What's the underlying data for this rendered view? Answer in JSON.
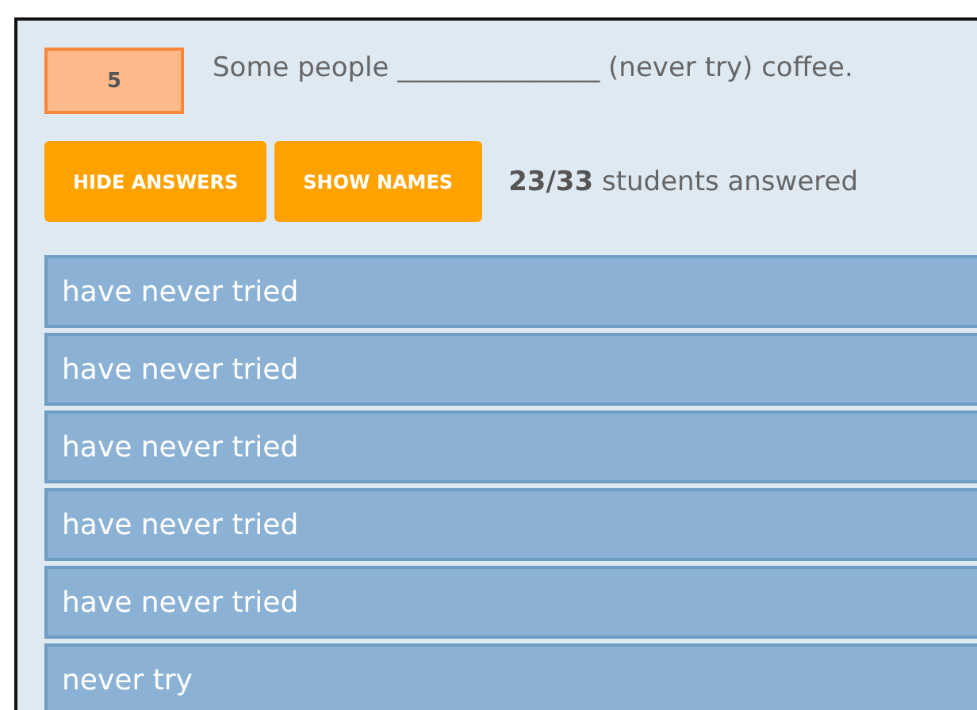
{
  "question": {
    "number": "5",
    "sentence": "Some people _______________ (never try) coffee."
  },
  "buttons": [
    "HIDE ANSWERS",
    "SHOW NAMES"
  ],
  "answered": "**23/33** students answered",
  "answers": [
    "have never tried",
    "have never tried",
    "have never tried",
    "have never tried",
    "have never tried",
    "never try"
  ]
}
